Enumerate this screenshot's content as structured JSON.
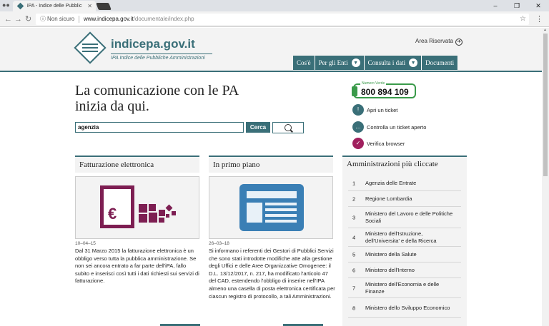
{
  "browser": {
    "tab_title": "iPA - Indice delle Pubblic",
    "not_secure": "Non sicuro",
    "url_host": "www.indicepa.gov.it",
    "url_path": "/documentale/index.php"
  },
  "header": {
    "site_name": "indicepa.gov.it",
    "site_subtitle": "IPA Indice delle Pubbliche Amministrazioni",
    "area_riservata": "Area Riservata",
    "nav": [
      {
        "label": "Cos'è"
      },
      {
        "label": "Per gli Enti"
      },
      {
        "label": "Consulta i dati"
      },
      {
        "label": "Documenti"
      }
    ]
  },
  "hero": {
    "line1": "La comunicazione con le PA",
    "line2": "inizia da qui."
  },
  "search": {
    "value": "agenzia",
    "button": "Cerca"
  },
  "contacts": {
    "numero_verde_label": "Numero Verde",
    "numero_verde": "800 894 109",
    "services": [
      {
        "label": "Apri un ticket",
        "icon": "ticket-icon",
        "color": "#3a6f78"
      },
      {
        "label": "Controlla un ticket aperto",
        "icon": "chat-icon",
        "color": "#3a6f78"
      },
      {
        "label": "Verifica browser",
        "icon": "check-icon",
        "color": "#a0205e"
      }
    ]
  },
  "cards": [
    {
      "title": "Fatturazione elettronica",
      "date": "10–04–15",
      "text": "Dal 31 Marzo 2015 la fatturazione elettronica è un obbligo verso tutta la pubblica amministrazione. Se non sei ancora entrato a far parte dell'iPA, fallo subito e inserisci così tutti i dati richiesti sui servizi di fatturazione."
    },
    {
      "title": "In primo piano",
      "date": "26–03–18",
      "text": "Si informano i referenti dei Gestori di Pubblici Servizi che sono stati introdotte modifiche atte alla gestione degli Uffici e delle Aree Organizzative Omogenee: il D.L. 13/12/2017, n. 217, ha modificato l'articolo 47 del CAD, estendendo l'obbligo di inserire nell'IPA almeno una casella di posta elettronica certificata per ciascun registro di protocollo, a tali Amministrazioni."
    }
  ],
  "amministrazioni": {
    "title": "Amministrazioni più cliccate",
    "items": [
      {
        "n": "1",
        "label": "Agenzia delle Entrate"
      },
      {
        "n": "2",
        "label": "Regione Lombardia"
      },
      {
        "n": "3",
        "label": "Ministero del Lavoro e delle Politiche Sociali"
      },
      {
        "n": "4",
        "label": "Ministero dell'Istruzione, dell'Universita' e della Ricerca"
      },
      {
        "n": "5",
        "label": "Ministero della Salute"
      },
      {
        "n": "6",
        "label": "Ministero dell'Interno"
      },
      {
        "n": "7",
        "label": "Ministero dell'Economia e delle Finanze"
      },
      {
        "n": "8",
        "label": "Ministero dello Sviluppo Economico"
      }
    ]
  },
  "colors": {
    "accent": "#3a6f78",
    "invoice": "#7d1e52",
    "news": "#3a7fb5",
    "green": "#3a9a4a"
  }
}
